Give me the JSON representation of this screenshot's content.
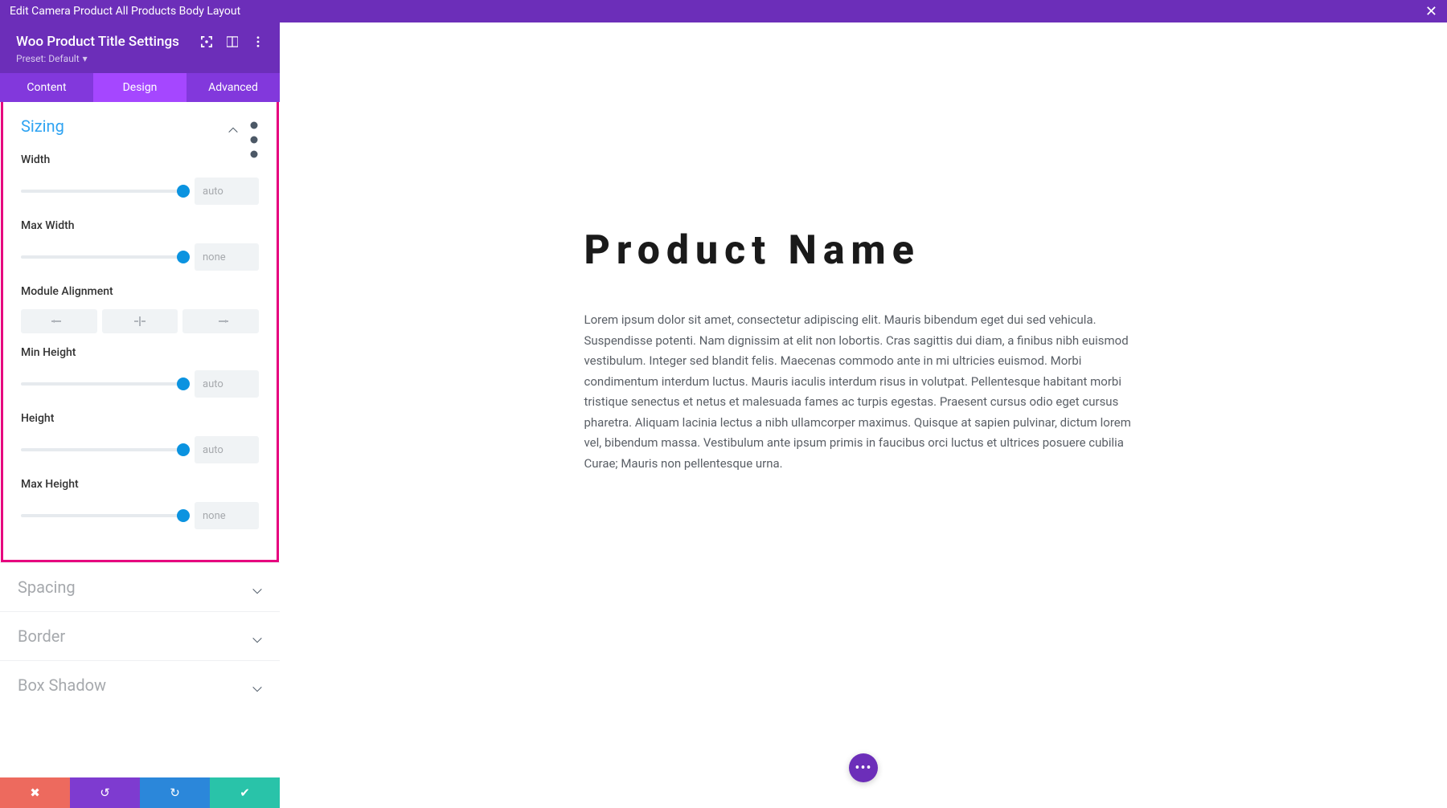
{
  "topbar": {
    "title": "Edit Camera Product All Products Body Layout"
  },
  "header": {
    "title": "Woo Product Title Settings",
    "preset_label": "Preset: Default"
  },
  "tabs": {
    "content": "Content",
    "design": "Design",
    "advanced": "Advanced",
    "active": "design"
  },
  "sections": {
    "sizing": {
      "title": "Sizing",
      "width": {
        "label": "Width",
        "value": "auto"
      },
      "max_width": {
        "label": "Max Width",
        "value": "none"
      },
      "alignment": {
        "label": "Module Alignment"
      },
      "min_height": {
        "label": "Min Height",
        "value": "auto"
      },
      "height": {
        "label": "Height",
        "value": "auto"
      },
      "max_height": {
        "label": "Max Height",
        "value": "none"
      }
    },
    "spacing": {
      "title": "Spacing"
    },
    "border": {
      "title": "Border"
    },
    "box_shadow": {
      "title": "Box Shadow"
    }
  },
  "preview": {
    "title": "Product Name",
    "body": "Lorem ipsum dolor sit amet, consectetur adipiscing elit. Mauris bibendum eget dui sed vehicula. Suspendisse potenti. Nam dignissim at elit non lobortis. Cras sagittis dui diam, a finibus nibh euismod vestibulum. Integer sed blandit felis. Maecenas commodo ante in mi ultricies euismod. Morbi condimentum interdum luctus. Mauris iaculis interdum risus in volutpat. Pellentesque habitant morbi tristique senectus et netus et malesuada fames ac turpis egestas. Praesent cursus odio eget cursus pharetra. Aliquam lacinia lectus a nibh ullamcorper maximus. Quisque at sapien pulvinar, dictum lorem vel, bibendum massa. Vestibulum ante ipsum primis in faucibus orci luctus et ultrices posuere cubilia Curae; Mauris non pellentesque urna."
  }
}
